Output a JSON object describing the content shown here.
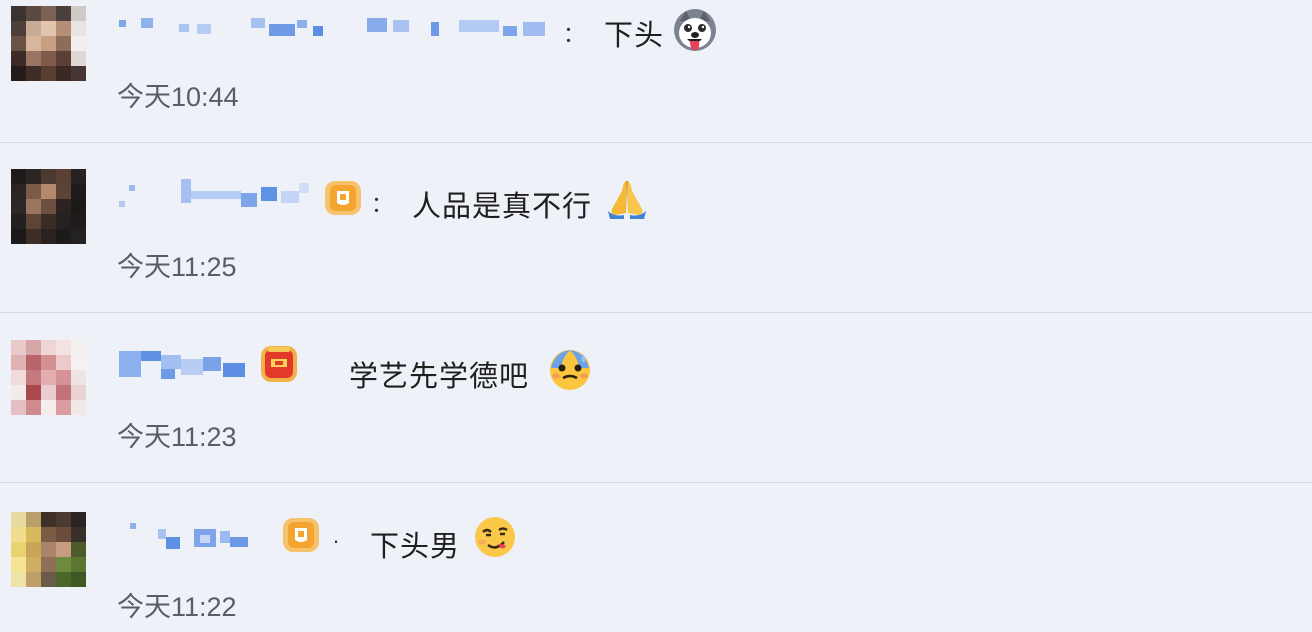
{
  "comments": [
    {
      "separator": "：",
      "text": "下头",
      "time": "今天10:44",
      "emoji": "husky-tongue-emoji"
    },
    {
      "separator": "：",
      "text": "人品是真不行",
      "time": "今天11:25",
      "emoji": "praying-hands-emoji"
    },
    {
      "separator": "",
      "text": "学艺先学德吧",
      "time": "今天11:23",
      "emoji": "sweating-face-emoji"
    },
    {
      "separator": ".",
      "text": "下头男",
      "time": "今天11:22",
      "emoji": "smirking-face-emoji"
    }
  ],
  "colors": {
    "background": "#eef1f8",
    "divider": "#d4d8e2",
    "blurred_name": "#6f9be6",
    "badge_orange": "#f3a52f",
    "badge_red": "#e2392b"
  }
}
